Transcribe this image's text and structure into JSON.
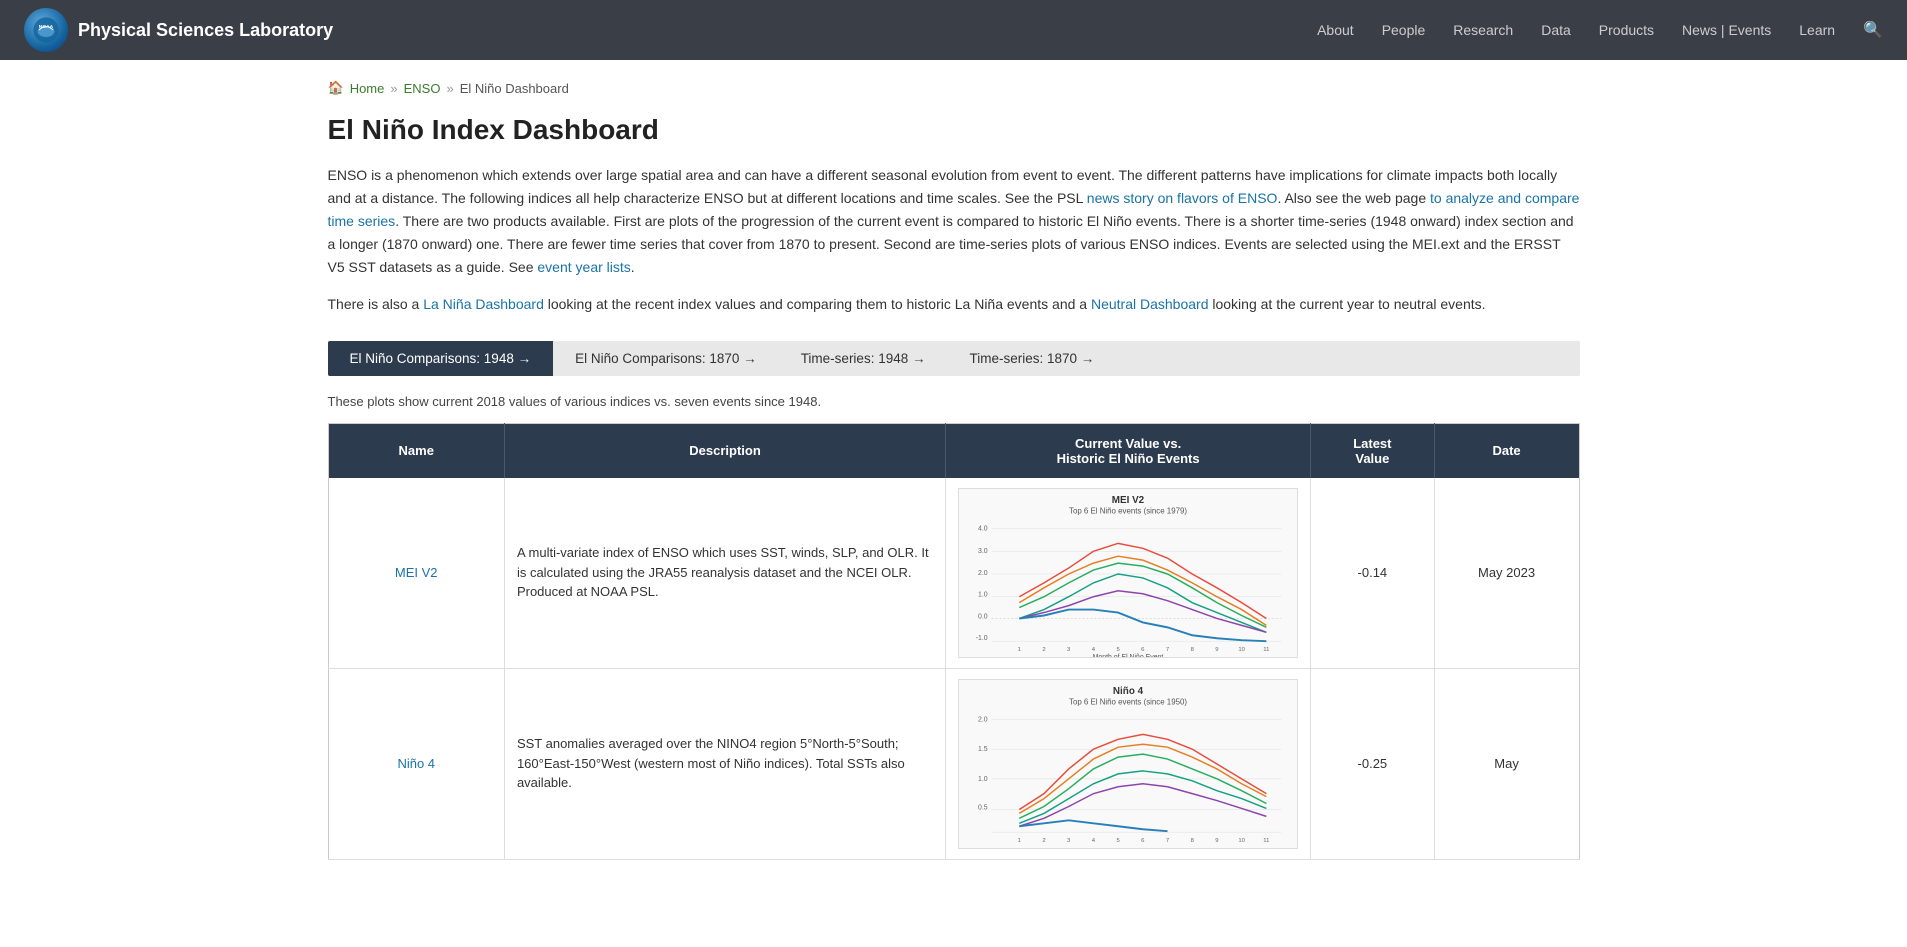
{
  "header": {
    "logo_alt": "NOAA",
    "site_title": "Physical Sciences Laboratory",
    "nav": [
      {
        "label": "About",
        "id": "about"
      },
      {
        "label": "People",
        "id": "people"
      },
      {
        "label": "Research",
        "id": "research"
      },
      {
        "label": "Data",
        "id": "data"
      },
      {
        "label": "Products",
        "id": "products"
      },
      {
        "label": "News | Events",
        "id": "news-events"
      },
      {
        "label": "Learn",
        "id": "learn"
      }
    ]
  },
  "breadcrumb": {
    "home": "Home",
    "sep1": "»",
    "enso": "ENSO",
    "sep2": "»",
    "current": "El Niño Dashboard"
  },
  "page_title": "El Niño Index Dashboard",
  "body_text_1": "ENSO is a phenomenon which extends over large spatial area and can have a different seasonal evolution from event to event. The different patterns have implications for climate impacts both locally and at a distance. The following indices all help characterize ENSO but at different locations and time scales. See the PSL ",
  "link_news": "news story on flavors of ENSO",
  "body_text_2": ". Also see the web page ",
  "link_analyze": "to analyze and compare time series",
  "body_text_3": ". There are two products available. First are plots of the progression of the current event is compared to historic El Niño events. There is a shorter time-series (1948 onward) index section and a longer (1870 onward) one. There are fewer time series that cover from 1870 to present. Second are time-series plots of various ENSO indices. Events are selected using the MEI.ext and the ERSST V5 SST datasets as a guide. See ",
  "link_events": "event year lists",
  "body_text_4": ".",
  "body_text_5": "There is also a ",
  "link_lanina": "La Niña Dashboard",
  "body_text_6": " looking at the recent index values and comparing them to historic La Niña events and a ",
  "link_neutral": "Neutral Dashboard",
  "body_text_7": " looking at the current year to neutral events.",
  "tabs": [
    {
      "label": "El Niño Comparisons: 1948 →",
      "active": true
    },
    {
      "label": "El Niño Comparisons: 1870 →",
      "active": false
    },
    {
      "label": "Time-series: 1948 →",
      "active": false
    },
    {
      "label": "Time-series: 1870 →",
      "active": false
    }
  ],
  "sub_info": "These plots show current 2018 values of various indices vs. seven events since 1948.",
  "table": {
    "headers": [
      "Name",
      "Description",
      "Current Value vs.\nHistoric El Niño Events",
      "Latest\nValue",
      "Date"
    ],
    "rows": [
      {
        "name": "MEI V2",
        "name_link": "#mei-v2",
        "description": "A multi-variate index of ENSO which uses SST, winds, SLP, and OLR. It is calculated using the JRA55 reanalysis dataset and the NCEI OLR. Produced at NOAA PSL.",
        "chart_title": "MEI V2",
        "chart_subtitle": "Top 6 El Niño events (since 1979)",
        "latest_value": "-0.14",
        "date": "May 2023"
      },
      {
        "name": "Niño 4",
        "name_link": "#nino4",
        "description": "SST anomalies averaged over the NINO4 region 5°North-5°South; 160°East-150°West (western most of Niño indices). Total SSTs also available.",
        "chart_title": "Niño 4",
        "chart_subtitle": "Top 6 El Niño events (since 1950)",
        "latest_value": "-0.25",
        "date": "May"
      }
    ]
  }
}
